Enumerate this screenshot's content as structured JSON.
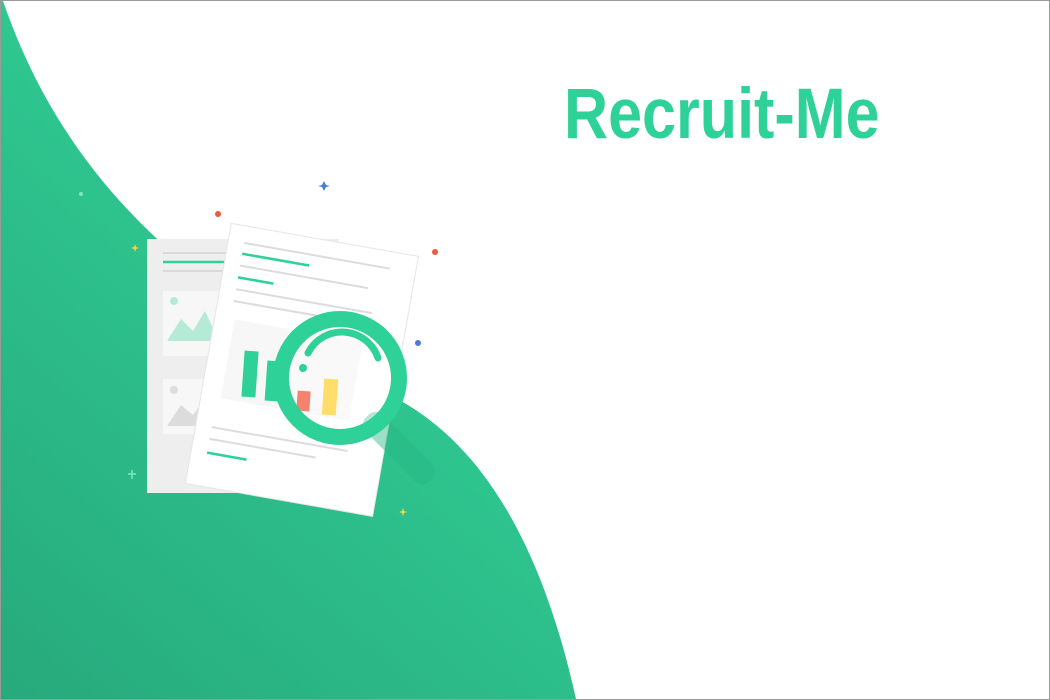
{
  "app": {
    "title": "Recruit-Me"
  },
  "colors": {
    "brand_green": "#2ed198",
    "wave_dark": "#27a97c",
    "wave_light": "#33d69b",
    "accent_red": "#f05a3c",
    "accent_yellow": "#ffd23a",
    "accent_blue": "#4a7bd6"
  },
  "illustration": {
    "icons": [
      "document-icon",
      "magnifier-icon",
      "bar-chart-icon",
      "image-placeholder-icon",
      "sparkle-icon"
    ]
  }
}
